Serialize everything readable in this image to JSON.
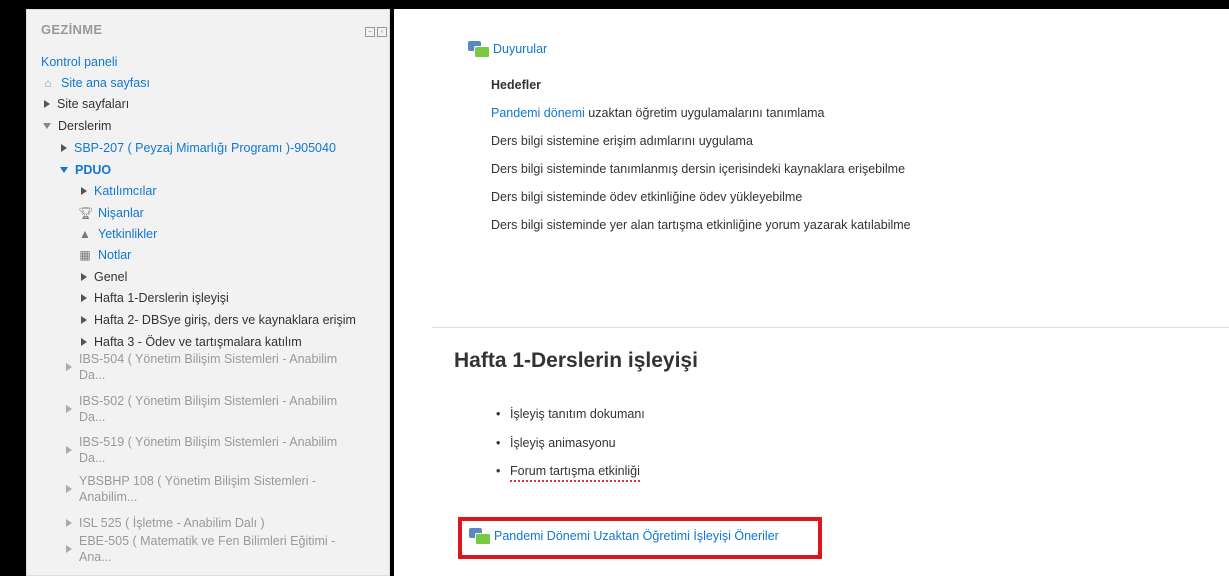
{
  "sidebar": {
    "header": "GEZİNME",
    "items": [
      {
        "label": "Kontrol paneli"
      },
      {
        "label": "Site ana sayfası"
      },
      {
        "label": "Site sayfaları"
      },
      {
        "label": "Derslerim"
      },
      {
        "label": "SBP-207 ( Peyzaj Mimarlığı Programı )-905040"
      },
      {
        "label": "PDUO"
      },
      {
        "label": "Katılımcılar"
      },
      {
        "label": "Nişanlar"
      },
      {
        "label": "Yetkinlikler"
      },
      {
        "label": "Notlar"
      },
      {
        "label": "Genel"
      },
      {
        "label": "Hafta 1-Derslerin işleyişi"
      },
      {
        "label": "Hafta 2- DBSye giriş, ders ve kaynaklara erişim"
      },
      {
        "label": "Hafta 3 - Ödev ve tartışmalara katılım"
      },
      {
        "line1": "IBS-504 ( Yönetim Bilişim Sistemleri - Anabilim",
        "line2": "Da..."
      },
      {
        "line1": "IBS-502 ( Yönetim Bilişim Sistemleri - Anabilim",
        "line2": "Da..."
      },
      {
        "line1": "IBS-519 ( Yönetim Bilişim Sistemleri - Anabilim",
        "line2": "Da..."
      },
      {
        "line1": "YBSBHP 108 ( Yönetim Bilişim Sistemleri -",
        "line2": "Anabilim..."
      },
      {
        "label": "ISL 525 ( İşletme - Anabilim Dalı )"
      },
      {
        "line1": "EBE-505 ( Matematik ve Fen Bilimleri Eğitimi -",
        "line2": "Ana..."
      }
    ]
  },
  "content": {
    "announcements": "Duyurular",
    "goals_title": "Hedefler",
    "goals": [
      {
        "link": "Pandemi dönemi",
        "text": " uzaktan öğretim uygulamalarını tanımlama"
      },
      {
        "link": "",
        "text": "Ders bilgi sistemine erişim  adımlarını uygulama"
      },
      {
        "link": "",
        "text": "Ders bilgi sisteminde tanımlanmış dersin içerisindeki kaynaklara erişebilme"
      },
      {
        "link": "",
        "text": "Ders bilgi sisteminde  ödev etkinliğine ödev yükleyebilme"
      },
      {
        "link": "",
        "text": "Ders bilgi sisteminde yer alan tartışma etkinliğine yorum yazarak katılabilme"
      }
    ],
    "section_title": "Hafta 1-Derslerin işleyişi",
    "bullets": [
      "İşleyiş tanıtım dokumanı",
      "İşleyiş animasyonu",
      "Forum tartışma etkinliği"
    ],
    "highlight_link": "Pandemi Dönemi Uzaktan Öğretimi İşleyişi Öneriler"
  },
  "colors": {
    "link": "#1177d1",
    "highlight_border": "#e0151b"
  }
}
